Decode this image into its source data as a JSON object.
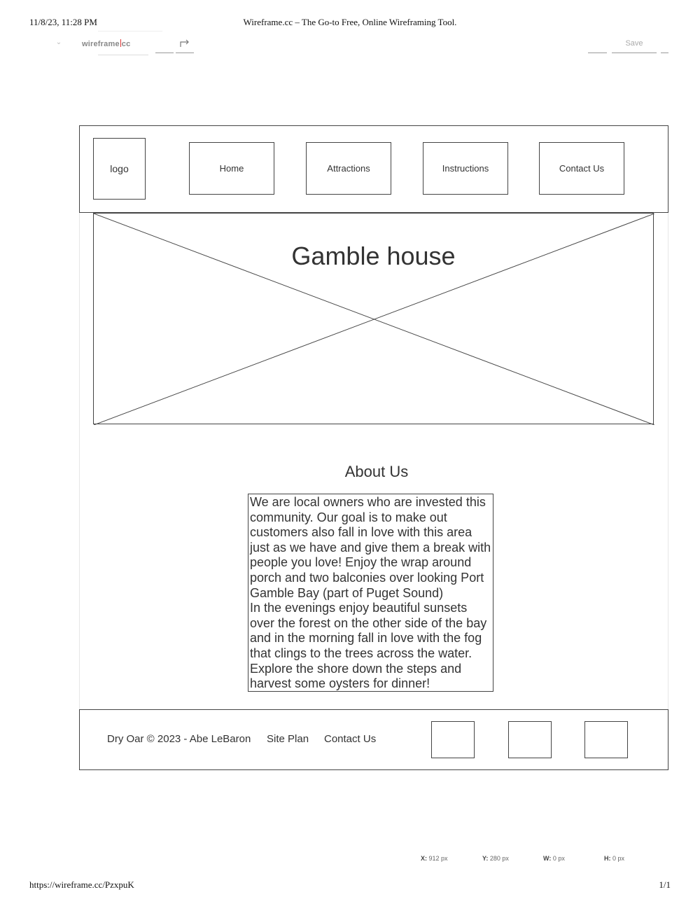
{
  "print_header": {
    "datetime": "11/8/23, 11:28 PM",
    "title": "Wireframe.cc – The Go-to Free, Online Wireframing Tool."
  },
  "print_footer": {
    "url": "https://wireframe.cc/PzxpuK",
    "page": "1/1"
  },
  "toolbar": {
    "brand_left": "wireframe",
    "brand_right": "cc",
    "save_label": "Save",
    "icons": [
      "chevron-down-icon",
      "redo-icon"
    ]
  },
  "wireframe": {
    "logo_label": "logo",
    "nav": [
      "Home",
      "Attractions",
      "Instructions",
      "Contact Us"
    ],
    "hero_title": "Gamble house",
    "about_title": "About Us",
    "about_text": "We are local owners who are invested this community. Our goal is to make out customers also fall in love with this area just as we have and give them a break with people you love! Enjoy the wrap around porch and two balconies over looking Port Gamble Bay (part of Puget Sound)\nIn the evenings enjoy beautiful sunsets over the forest on the other side of the bay and in the morning fall in love with the fog that clings to the trees across the water. Explore the shore down the steps and harvest some oysters for dinner!",
    "footer": {
      "copyright": "Dry Oar © 2023 - Abe LeBaron",
      "site_plan": "Site Plan",
      "contact": "Contact Us"
    }
  },
  "status": {
    "x_label": "X:",
    "x_value": "912 px",
    "y_label": "Y:",
    "y_value": "280 px",
    "w_label": "W:",
    "w_value": "0 px",
    "h_label": "H:",
    "h_value": "0 px"
  }
}
